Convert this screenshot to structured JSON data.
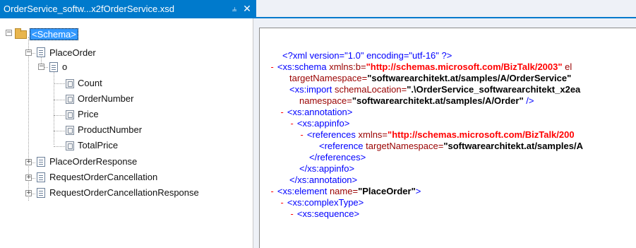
{
  "tab": {
    "title": "OrderService_softw...x2fOrderService.xsd",
    "pin_glyph": "⫨",
    "close_glyph": "✕"
  },
  "tree": {
    "schema_label": "<Schema>",
    "place_order": "PlaceOrder",
    "o": "o",
    "fields": [
      "Count",
      "OrderNumber",
      "Price",
      "ProductNumber",
      "TotalPrice"
    ],
    "collapsed": [
      "PlaceOrderResponse",
      "RequestOrderCancellation",
      "RequestOrderCancellationResponse"
    ]
  },
  "xml": {
    "l1_pi": "<?xml version=\"1.0\" encoding=\"utf-16\" ?>",
    "l2_tag": "<xs:schema ",
    "l2_attr": "xmlns:b=",
    "l2_val": "\"http://schemas.microsoft.com/BizTalk/2003\"",
    "l2_tail": " el",
    "l3_attr": "targetNamespace=",
    "l3_val": "\"softwarearchitekt.at/samples/A/OrderService\"",
    "l4_tag": "<xs:import ",
    "l4_attr": "schemaLocation=",
    "l4_val": "\".\\OrderService_softwarearchitekt_x2ea",
    "l5_attr": "namespace=",
    "l5_val": "\"softwarearchitekt.at/samples/A/Order\"",
    "l5_end": " />",
    "l6": "<xs:annotation>",
    "l7": "<xs:appinfo>",
    "l8_tag": "<references ",
    "l8_attr": "xmlns=",
    "l8_val": "\"http://schemas.microsoft.com/BizTalk/200",
    "l9_tag": "<reference ",
    "l9_attr": "targetNamespace=",
    "l9_val": "\"softwarearchitekt.at/samples/A",
    "l10": "</references>",
    "l11": "</xs:appinfo>",
    "l12": "</xs:annotation>",
    "l13_tag": "<xs:element ",
    "l13_attr": "name=",
    "l13_val": "\"PlaceOrder\"",
    "l13_end": ">",
    "l14": "<xs:complexType>",
    "l15": "<xs:sequence>",
    "minus": "-"
  }
}
